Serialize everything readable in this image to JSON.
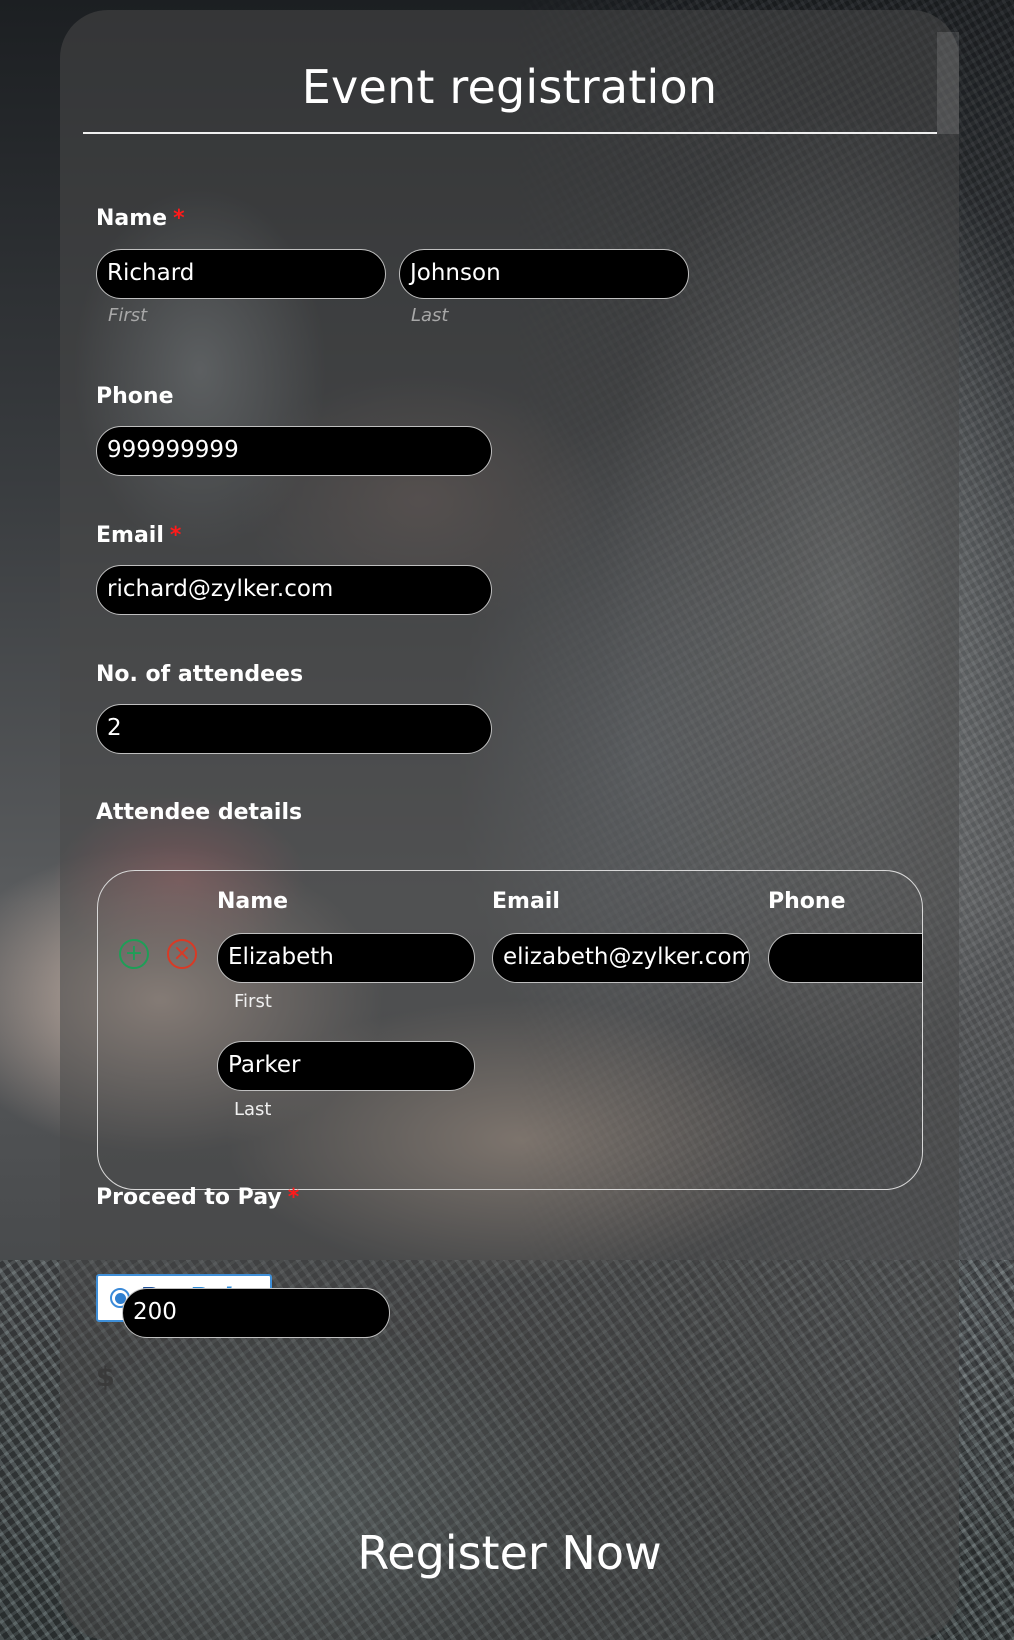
{
  "form": {
    "title": "Event registration",
    "required_marker": "*",
    "name": {
      "label": "Name",
      "required": true,
      "first_value": "Richard",
      "last_value": "Johnson",
      "first_sublabel": "First",
      "last_sublabel": "Last"
    },
    "phone": {
      "label": "Phone",
      "value": "999999999"
    },
    "email": {
      "label": "Email",
      "required": true,
      "value": "richard@zylker.com"
    },
    "attendees_count": {
      "label": "No. of attendees",
      "value": "2"
    },
    "attendee_details": {
      "label": "Attendee details",
      "columns": [
        "Name",
        "Email",
        "Phone"
      ],
      "rows": [
        {
          "first_name": "Elizabeth",
          "last_name": "Parker",
          "first_sublabel": "First",
          "last_sublabel": "Last",
          "email": "elizabeth@zylker.com",
          "phone": ""
        }
      ],
      "add_icon": "plus-circle-icon",
      "remove_icon": "x-circle-icon"
    },
    "payment": {
      "label": "Proceed to Pay",
      "required": true,
      "method": "PayPal",
      "method_part1": "Pay",
      "method_part2": "Pal",
      "selected": true,
      "currency_symbol": "$",
      "amount": "200"
    },
    "submit_label": "Register Now"
  },
  "colors": {
    "required": "#ff1a1a",
    "add": "#1e9e57",
    "remove": "#d93a25",
    "paypal_dark": "#1b4f99",
    "paypal_light": "#2c8ad8",
    "input_bg": "#000000"
  }
}
